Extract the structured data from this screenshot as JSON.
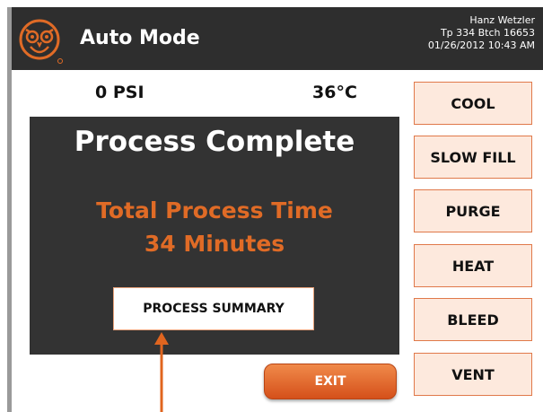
{
  "header": {
    "title": "Auto Mode",
    "user": "Hanz Wetzler",
    "batch": "Tp 334 Btch 16653",
    "datetime": "01/26/2012 10:43 AM",
    "logo_icon": "owl-logo-icon"
  },
  "readouts": {
    "pressure": "0 PSI",
    "temperature": "36°C"
  },
  "panel": {
    "title": "Process Complete",
    "line1": "Total Process Time",
    "line2": "34 Minutes",
    "summary_label": "PROCESS SUMMARY"
  },
  "side_buttons": {
    "cool": "COOL",
    "slow_fill": "SLOW FILL",
    "purge": "PURGE",
    "heat": "HEAT",
    "bleed": "BLEED",
    "vent": "VENT"
  },
  "exit_label": "EXIT",
  "colors": {
    "accent": "#e06b26",
    "header_bg": "#2e2e2e",
    "panel_bg": "#333333",
    "side_button_bg": "#fde9dd"
  }
}
